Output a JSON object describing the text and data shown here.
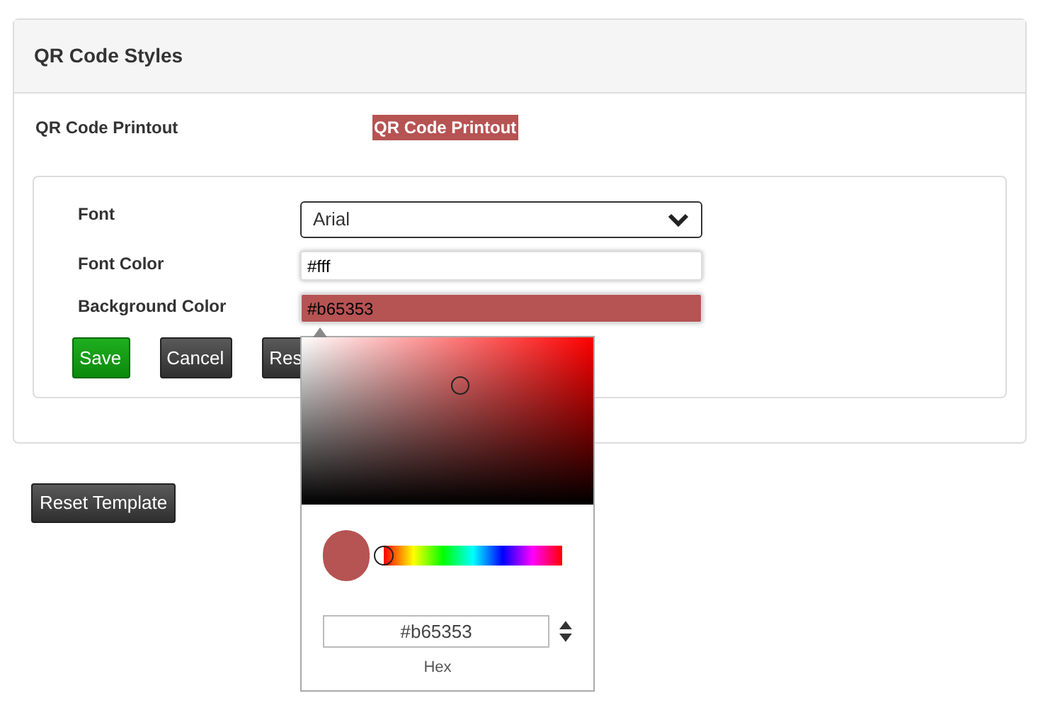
{
  "panel": {
    "title": "QR Code Styles"
  },
  "preview": {
    "label": "QR Code Printout",
    "sample": "QR Code Printout"
  },
  "form": {
    "fields": [
      {
        "kind": "select",
        "label": "Font",
        "value": "Arial"
      },
      {
        "kind": "color",
        "label": "Font Color",
        "value": "#fff"
      },
      {
        "kind": "color",
        "label": "Background Color",
        "value": "#b65353"
      }
    ],
    "buttons": [
      {
        "kind": "primary",
        "label": "Save"
      },
      {
        "kind": "dark",
        "label": "Cancel"
      },
      {
        "kind": "dark",
        "label": "Res"
      }
    ]
  },
  "color_picker": {
    "value": "#b65353",
    "hue": {
      "level": 0
    },
    "format_label": "Hex"
  },
  "reset_button": "Reset Template"
}
